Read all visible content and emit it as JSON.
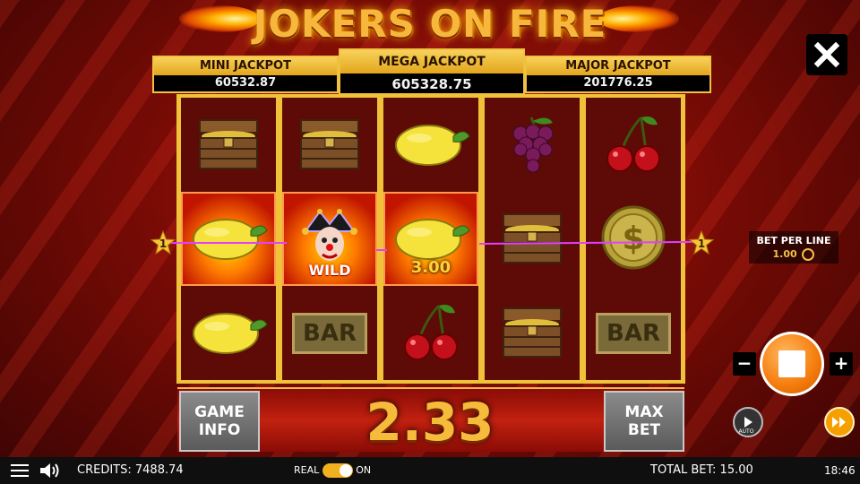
{
  "game": {
    "title": "JOKERS ON FIRE"
  },
  "jackpots": {
    "mini": {
      "label": "MINI JACKPOT",
      "value": "60532.87"
    },
    "mega": {
      "label": "MEGA JACKPOT",
      "value": "605328.75"
    },
    "major": {
      "label": "MAJOR JACKPOT",
      "value": "201776.25"
    }
  },
  "reels": [
    [
      "chest-icon",
      "lemon-icon",
      "lemon-icon"
    ],
    [
      "chest-icon",
      "joker-wild-icon",
      "bar-icon"
    ],
    [
      "lemon-icon",
      "lemon-icon",
      "cherry-icon"
    ],
    [
      "grapes-icon",
      "chest-icon",
      "chest-icon"
    ],
    [
      "cherry-icon",
      "dollar-coin-icon",
      "bar-icon"
    ]
  ],
  "symbols": {
    "wild_label": "WILD",
    "bar_label": "BAR"
  },
  "win_cell_amount": "3.00",
  "payline": {
    "left_number": "1",
    "right_number": "1"
  },
  "bet_per_line": {
    "label": "BET PER LINE",
    "value": "1.00"
  },
  "buttons": {
    "game_info": [
      "GAME",
      "INFO"
    ],
    "max_bet": [
      "MAX",
      "BET"
    ],
    "minus": "−",
    "plus": "+",
    "auto": "AUTO"
  },
  "win_amount": "2.33",
  "status_bar": {
    "credits_label": "CREDITS:",
    "credits_value": "7488.74",
    "real_label": "REAL",
    "on_label": "ON",
    "total_bet_label": "TOTAL BET:",
    "total_bet_value": "15.00",
    "clock": "18:46"
  },
  "colors": {
    "accent": "#f0c23a",
    "spin": "#f57d0d",
    "payline": "#e040ff"
  }
}
